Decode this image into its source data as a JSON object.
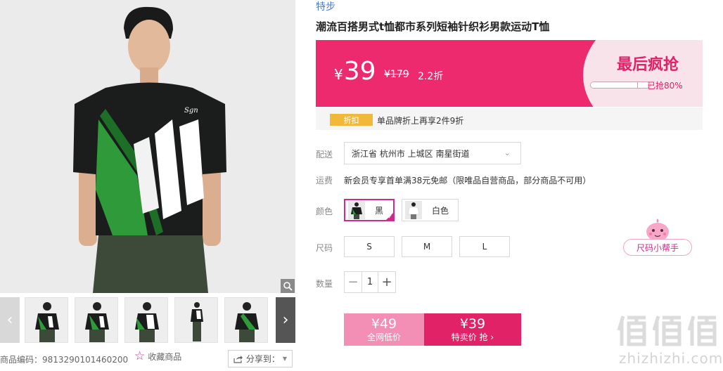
{
  "gallery": {
    "thumbs": [
      "thumb-1",
      "thumb-2",
      "thumb-3",
      "thumb-4",
      "thumb-5"
    ],
    "sku_code": "商品编码：9813290101460200",
    "favorite_label": "收藏商品",
    "share_label": "分享到："
  },
  "product": {
    "brand": "特步",
    "title": "潮流百搭男式t恤都市系列短袖针织衫男款运动T恤"
  },
  "price": {
    "currency": "¥",
    "current": "39",
    "original": "¥179",
    "discount": "2.2折",
    "rush_title": "最后疯抢",
    "sold_percent": 0.8,
    "sold_text": "已抢80%"
  },
  "promo": {
    "tag": "折扣",
    "text": "单品牌折上再享2件9折"
  },
  "delivery": {
    "label": "配送",
    "address": "浙江省 杭州市 上城区 南星街道"
  },
  "shipping": {
    "label": "运费",
    "text": "新会员专享首单满38元免邮（限唯品自营商品，部分商品不可用）"
  },
  "color": {
    "label": "颜色",
    "options": [
      {
        "label": "黑",
        "selected": true
      },
      {
        "label": "白色",
        "selected": false
      }
    ]
  },
  "size": {
    "label": "尺码",
    "options": [
      "S",
      "M",
      "L"
    ],
    "helper": "尺码小帮手"
  },
  "quantity": {
    "label": "数量",
    "value": "1"
  },
  "buy": {
    "lowest_price": "¥49",
    "lowest_label": "全网低价",
    "sale_price": "¥39",
    "sale_label": "特卖价 抢 ›"
  },
  "watermark": {
    "text": "zhizhizhi.com"
  },
  "colors": {
    "accent": "#e22266",
    "magenta": "#cc2c8a",
    "brand_link": "#4a7bc8",
    "promo_tag": "#f0b93a"
  }
}
